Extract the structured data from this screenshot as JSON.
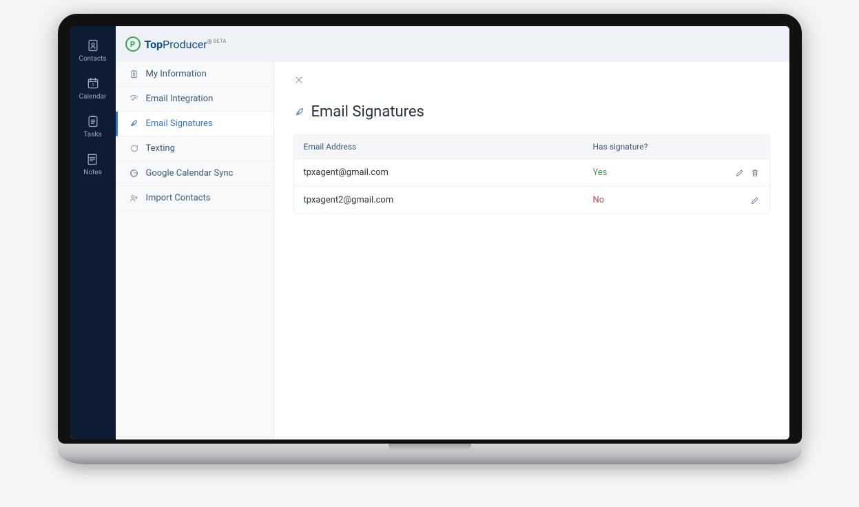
{
  "brand": {
    "name_a": "Top",
    "name_b": "Producer",
    "beta": "BETA"
  },
  "rail": [
    {
      "key": "contacts",
      "label": "Contacts"
    },
    {
      "key": "calendar",
      "label": "Calendar"
    },
    {
      "key": "tasks",
      "label": "Tasks"
    },
    {
      "key": "notes",
      "label": "Notes"
    }
  ],
  "settings_nav": [
    {
      "key": "my-info",
      "label": "My Information"
    },
    {
      "key": "email-int",
      "label": "Email Integration"
    },
    {
      "key": "email-sig",
      "label": "Email Signatures",
      "active": true
    },
    {
      "key": "texting",
      "label": "Texting"
    },
    {
      "key": "gcal",
      "label": "Google Calendar Sync"
    },
    {
      "key": "import",
      "label": "Import Contacts"
    }
  ],
  "page": {
    "title": "Email Signatures"
  },
  "table": {
    "cols": {
      "email": "Email Address",
      "sig": "Has signature?"
    },
    "rows": [
      {
        "email": "tpxagent@gmail.com",
        "has": "Yes",
        "has_class": "yes",
        "delete": true
      },
      {
        "email": "tpxagent2@gmail.com",
        "has": "No",
        "has_class": "no",
        "delete": false
      }
    ]
  }
}
